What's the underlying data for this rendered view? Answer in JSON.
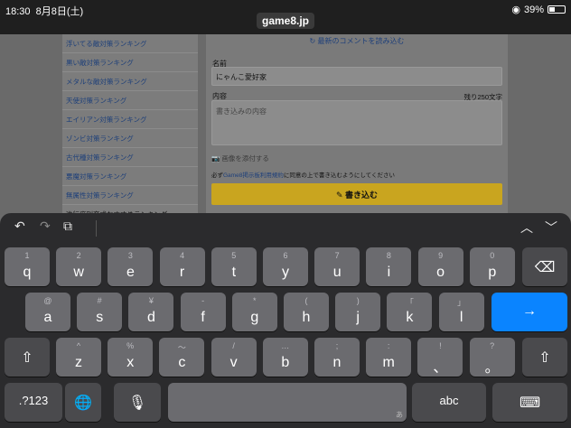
{
  "status": {
    "time": "18:30",
    "date": "8月8日(土)",
    "url": "game8.jp",
    "battery": "39%",
    "battery_level": 0.39
  },
  "sidebar": {
    "items": [
      {
        "label": "浮いてる敵対策ランキング",
        "dark": false
      },
      {
        "label": "黒い敵対策ランキング",
        "dark": false
      },
      {
        "label": "メタルな敵対策ランキング",
        "dark": false
      },
      {
        "label": "天使対策ランキング",
        "dark": false
      },
      {
        "label": "エイリアン対策ランキング",
        "dark": false
      },
      {
        "label": "ゾンビ対策ランキング",
        "dark": false
      },
      {
        "label": "古代種対策ランキング",
        "dark": false
      },
      {
        "label": "悪魔対策ランキング",
        "dark": false
      },
      {
        "label": "無属性対策ランキング",
        "dark": false
      },
      {
        "label": "進行度別育成おすすめランキング",
        "dark": true
      }
    ]
  },
  "form": {
    "reload": "最新のコメントを読み込む",
    "name_label": "名前",
    "name_value": "にゃんこ愛好家",
    "content_label": "内容",
    "remaining": "残り250文字",
    "content_placeholder": "書き込みの内容",
    "attach": "画像を添付する",
    "agree_pre": "必ず",
    "agree_link": "Game8掲示板利用規約",
    "agree_post": "に同意の上で書き込むようにしてください",
    "submit": "書き込む"
  },
  "keyboard": {
    "row1": [
      {
        "main": "q",
        "sub": "1"
      },
      {
        "main": "w",
        "sub": "2"
      },
      {
        "main": "e",
        "sub": "3"
      },
      {
        "main": "r",
        "sub": "4"
      },
      {
        "main": "t",
        "sub": "5"
      },
      {
        "main": "y",
        "sub": "6"
      },
      {
        "main": "u",
        "sub": "7"
      },
      {
        "main": "i",
        "sub": "8"
      },
      {
        "main": "o",
        "sub": "9"
      },
      {
        "main": "p",
        "sub": "0"
      }
    ],
    "row2": [
      {
        "main": "a",
        "sub": "@"
      },
      {
        "main": "s",
        "sub": "#"
      },
      {
        "main": "d",
        "sub": "¥"
      },
      {
        "main": "f",
        "sub": "-"
      },
      {
        "main": "g",
        "sub": "*"
      },
      {
        "main": "h",
        "sub": "("
      },
      {
        "main": "j",
        "sub": ")"
      },
      {
        "main": "k",
        "sub": "「"
      },
      {
        "main": "l",
        "sub": "」"
      }
    ],
    "row3": [
      {
        "main": "z",
        "sub": "^"
      },
      {
        "main": "x",
        "sub": "%"
      },
      {
        "main": "c",
        "sub": "〜"
      },
      {
        "main": "v",
        "sub": "/"
      },
      {
        "main": "b",
        "sub": "…"
      },
      {
        "main": "n",
        "sub": ";"
      },
      {
        "main": "m",
        "sub": ":"
      },
      {
        "main": "、",
        "sub": "!"
      },
      {
        "main": "。",
        "sub": "?"
      }
    ],
    "numbers_key": ".?123",
    "abc_key": "abc",
    "space_tag": "あ",
    "icons": [
      "undo-icon",
      "redo-icon",
      "paste-icon",
      "chevron-up-icon",
      "chevron-down-icon",
      "delete-icon",
      "return-icon",
      "shift-icon",
      "globe-icon",
      "microphone-icon",
      "keyboard-dismiss-icon"
    ]
  }
}
